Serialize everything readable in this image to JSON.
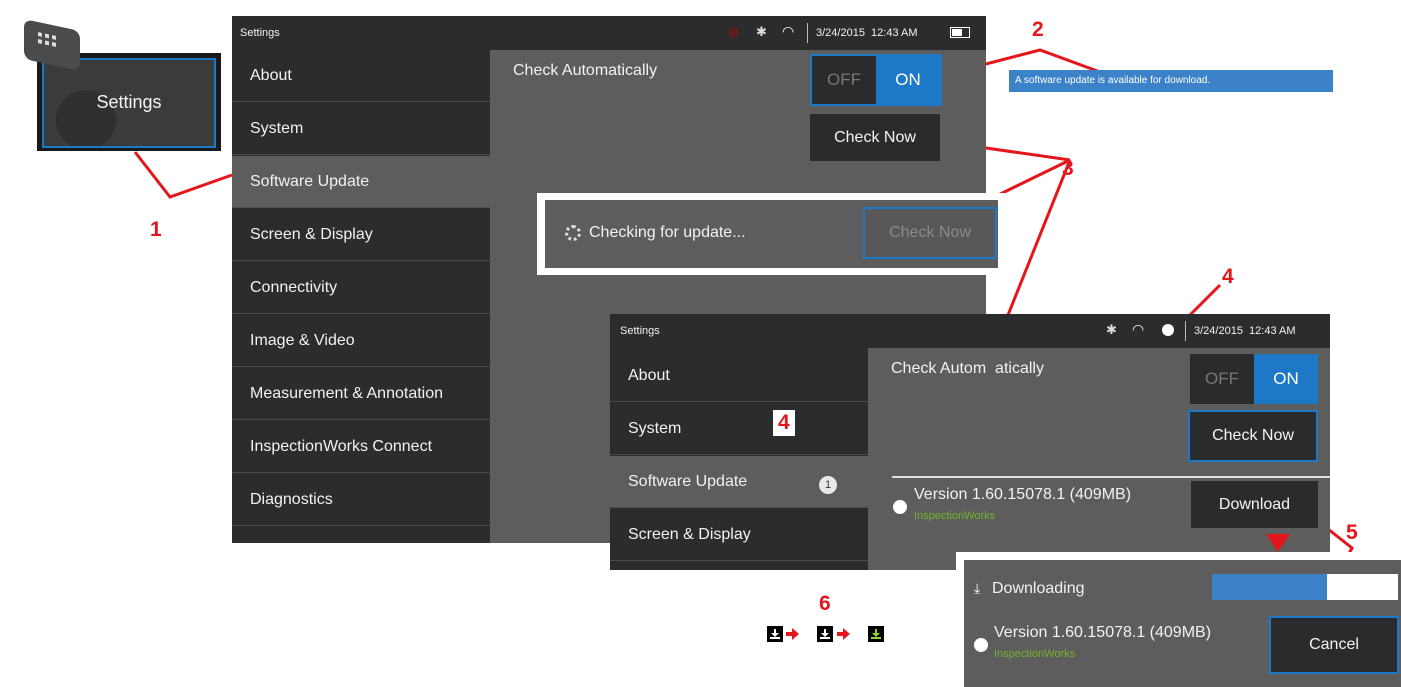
{
  "launcher": {
    "label": "Settings"
  },
  "screen1": {
    "status": {
      "title": "Settings",
      "datetime": "3/24/2015  12:43 AM"
    },
    "menu": [
      "About",
      "System",
      "Software Update",
      "Screen & Display",
      "Connectivity",
      "Image & Video",
      "Measurement & Annotation",
      "InspectionWorks Connect",
      "Diagnostics"
    ],
    "check_auto_label": "Check Automatically",
    "toggle": {
      "off": "OFF",
      "on": "ON"
    },
    "check_now": "Check Now"
  },
  "checking": {
    "text": "Checking for update...",
    "button": "Check Now"
  },
  "banner": {
    "text": "A software update is available for download."
  },
  "screen2": {
    "status": {
      "title": "Settings",
      "datetime": "3/24/2015  12:43 AM"
    },
    "menu": [
      "About",
      "System",
      "Software Update",
      "Screen & Display"
    ],
    "badge": "1",
    "check_auto_label": "Check Autom  atically",
    "toggle": {
      "off": "OFF",
      "on": "ON"
    },
    "check_now": "Check Now",
    "version": "Version 1.60.15078.1 (409MB)",
    "vendor": "InspectionWorks",
    "download": "Download"
  },
  "download_panel": {
    "downloading": "Downloading",
    "progress": 0.62,
    "version": "Version 1.60.15078.1 (409MB)",
    "vendor": "InspectionWorks",
    "cancel": "Cancel"
  },
  "callouts": [
    "1",
    "2",
    "3",
    "4",
    "4",
    "5",
    "6"
  ],
  "colors": {
    "accent": "#1e78c8",
    "callout": "#e4161c",
    "vendor_green": "#74b22a"
  }
}
